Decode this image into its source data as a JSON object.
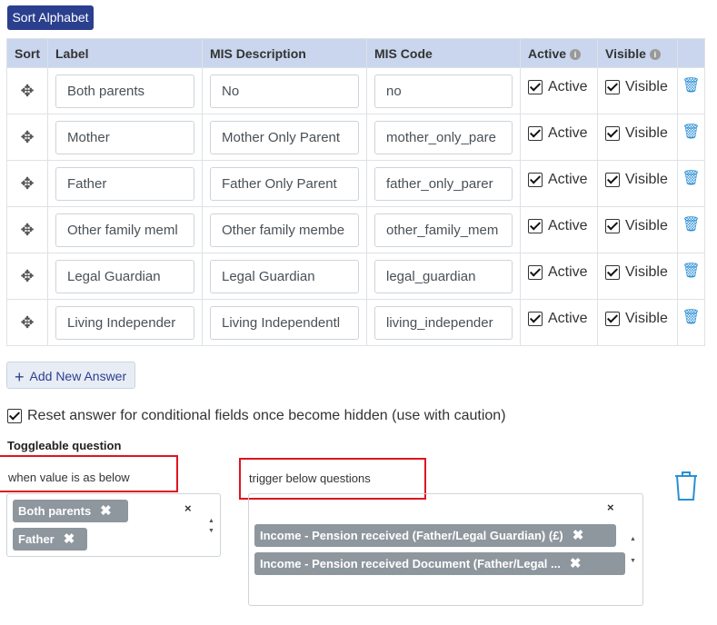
{
  "toolbar": {
    "sort_label": "Sort Alphabet"
  },
  "table": {
    "headers": {
      "sort": "Sort",
      "label": "Label",
      "mis_description": "MIS Description",
      "mis_code": "MIS Code",
      "active": "Active",
      "visible": "Visible"
    },
    "info_glyph": "i",
    "rows": [
      {
        "label": "Both parents",
        "mis_description": "No",
        "mis_code": "no",
        "active": true,
        "visible": true
      },
      {
        "label": "Mother",
        "mis_description": "Mother Only Parent",
        "mis_code": "mother_only_pare",
        "active": true,
        "visible": true
      },
      {
        "label": "Father",
        "mis_description": "Father Only Parent",
        "mis_code": "father_only_parer",
        "active": true,
        "visible": true
      },
      {
        "label": "Other family meml",
        "mis_description": "Other family membe",
        "mis_code": "other_family_mem",
        "active": true,
        "visible": true
      },
      {
        "label": "Legal Guardian",
        "mis_description": "Legal Guardian",
        "mis_code": "legal_guardian",
        "active": true,
        "visible": true
      },
      {
        "label": "Living Independer",
        "mis_description": "Living Independentl",
        "mis_code": "living_independer",
        "active": true,
        "visible": true
      }
    ],
    "active_label": "Active",
    "visible_label": "Visible"
  },
  "add_answer_label": "Add New Answer",
  "reset_checkbox": {
    "checked": true,
    "label": "Reset answer for conditional fields once become hidden (use with caution)"
  },
  "toggleable": {
    "title": "Toggleable question",
    "when_label": "when value is as below",
    "trigger_label": "trigger below questions",
    "when_values": [
      "Both parents",
      "Father"
    ],
    "trigger_values": [
      "Income - Pension received (Father/Legal Guardian) (£)",
      "Income - Pension received Document (Father/Legal ..."
    ]
  },
  "icons": {
    "move": "move-icon",
    "delete": "trash-icon",
    "info": "info-icon",
    "remove_tag": "close-icon",
    "plus": "plus-icon"
  },
  "colors": {
    "primary": "#2b3f8f",
    "header_bg": "#c9d6ee",
    "tag_bg": "#8e969e",
    "highlight": "#e0141e",
    "trash": "#2b8fd6"
  }
}
